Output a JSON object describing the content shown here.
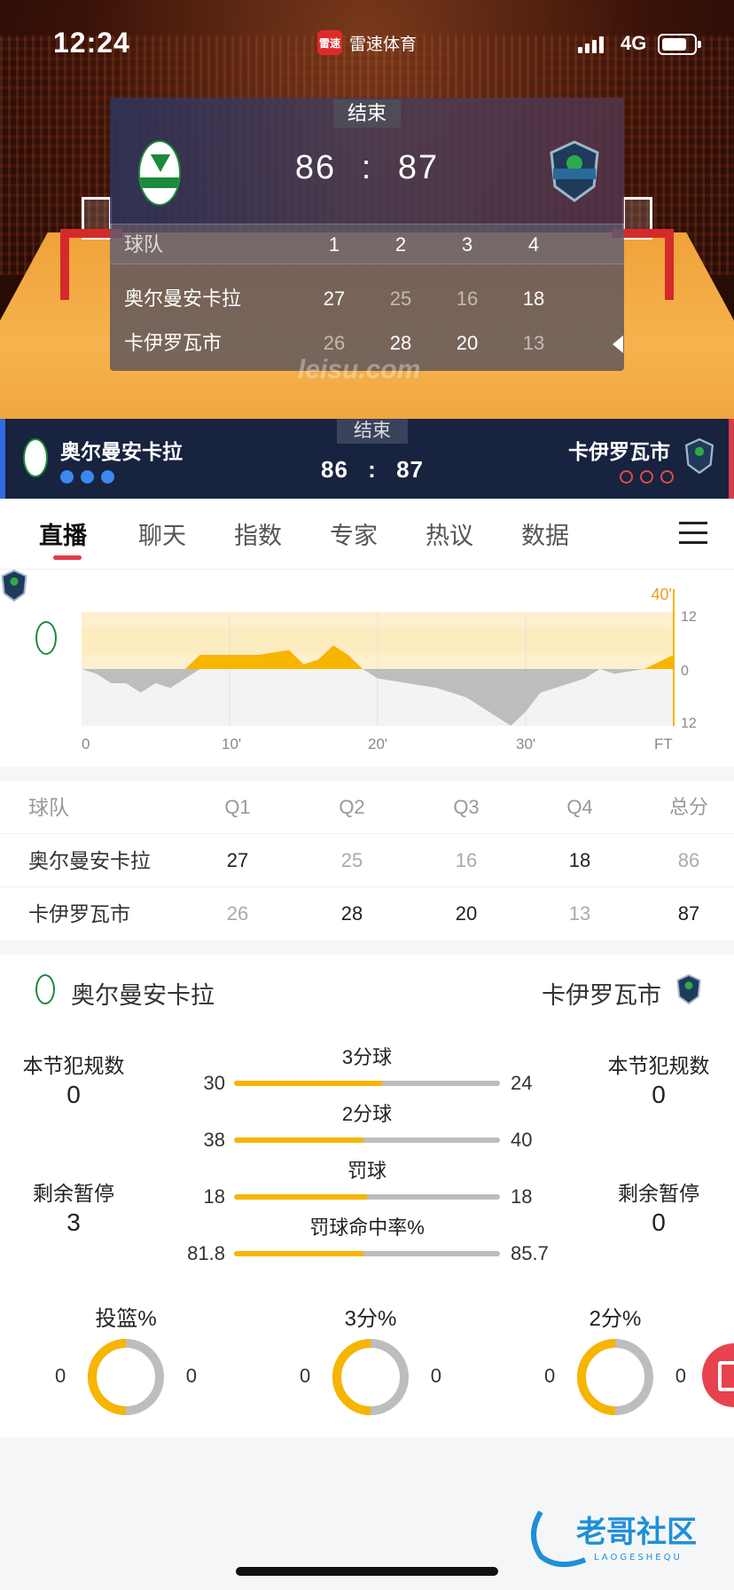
{
  "status_bar": {
    "time": "12:24",
    "app_icon_text": "雷速",
    "app_name": "雷速体育",
    "network": "4G",
    "battery_level": 0.8
  },
  "match": {
    "status": "结束",
    "home_team": "奥尔曼安卡拉",
    "away_team": "卡伊罗瓦市",
    "home_score": "86",
    "away_score": "87",
    "separator": ":",
    "home_logo_text": "OGM ORMAN SPOR"
  },
  "quarters_panel": {
    "header": {
      "team": "球队",
      "q1": "1",
      "q2": "2",
      "q3": "3",
      "q4": "4"
    },
    "rows": [
      {
        "team": "奥尔曼安卡拉",
        "scores": [
          "27",
          "25",
          "16",
          "18"
        ]
      },
      {
        "team": "卡伊罗瓦市",
        "scores": [
          "26",
          "28",
          "20",
          "13"
        ]
      }
    ]
  },
  "watermark": "leisu.com",
  "tabs": [
    "直播",
    "聊天",
    "指数",
    "专家",
    "热议",
    "数据"
  ],
  "active_tab": 0,
  "trend": {
    "current_minute_label": "40'",
    "y_labels": [
      "12",
      "0",
      "12"
    ],
    "x_labels": [
      "0",
      "10'",
      "20'",
      "30'",
      "FT"
    ],
    "accent_color": "#f7b500",
    "chart_data": {
      "type": "area",
      "xlabel": "",
      "ylabel": "",
      "x": [
        0,
        1,
        2,
        3,
        4,
        5,
        6,
        7,
        8,
        9,
        10,
        12,
        14,
        15,
        16,
        17,
        18,
        19,
        20,
        22,
        24,
        26,
        28,
        29,
        30,
        31,
        32,
        34,
        35,
        36,
        38,
        40
      ],
      "values": [
        0,
        -1,
        -3,
        -3,
        -5,
        -3,
        -4,
        -2,
        3,
        3,
        3,
        3,
        4,
        1,
        2,
        5,
        3,
        0,
        -2,
        -3,
        -4,
        -6,
        -10,
        -12,
        -9,
        -5,
        -4,
        -2,
        0,
        -1,
        0,
        3
      ],
      "ylim": [
        -12,
        12
      ],
      "xlim": [
        0,
        40
      ]
    }
  },
  "quarter_table": {
    "headers": [
      "球队",
      "Q1",
      "Q2",
      "Q3",
      "Q4",
      "总分"
    ],
    "rows": [
      {
        "team": "奥尔曼安卡拉",
        "scores": [
          "27",
          "25",
          "16",
          "18",
          "86"
        ],
        "win": [
          true,
          false,
          false,
          true,
          false
        ]
      },
      {
        "team": "卡伊罗瓦市",
        "scores": [
          "26",
          "28",
          "20",
          "13",
          "87"
        ],
        "win": [
          false,
          true,
          true,
          false,
          true
        ]
      }
    ]
  },
  "stats": {
    "home_team": "奥尔曼安卡拉",
    "away_team": "卡伊罗瓦市",
    "home_fouls_label": "本节犯规数",
    "home_fouls": "0",
    "away_fouls_label": "本节犯规数",
    "away_fouls": "0",
    "home_timeouts_label": "剩余暂停",
    "home_timeouts": "3",
    "away_timeouts_label": "剩余暂停",
    "away_timeouts": "0",
    "bars": [
      {
        "title": "3分球",
        "home": "30",
        "away": "24",
        "home_ratio": 0.556
      },
      {
        "title": "2分球",
        "home": "38",
        "away": "40",
        "home_ratio": 0.487
      },
      {
        "title": "罚球",
        "home": "18",
        "away": "18",
        "home_ratio": 0.5
      },
      {
        "title": "罚球命中率%",
        "home": "81.8",
        "away": "85.7",
        "home_ratio": 0.488
      }
    ],
    "donuts": [
      {
        "title": "投篮%",
        "home": "0",
        "away": "0",
        "home_ratio": 0.5
      },
      {
        "title": "3分%",
        "home": "0",
        "away": "0",
        "home_ratio": 0.5
      },
      {
        "title": "2分%",
        "home": "0",
        "away": "0",
        "home_ratio": 0.5
      }
    ],
    "home_color": "#f7b500",
    "away_color": "#bdbdbd"
  },
  "footer": {
    "logo_text": "老哥社区",
    "logo_sub": "LAOGESHEQU"
  }
}
